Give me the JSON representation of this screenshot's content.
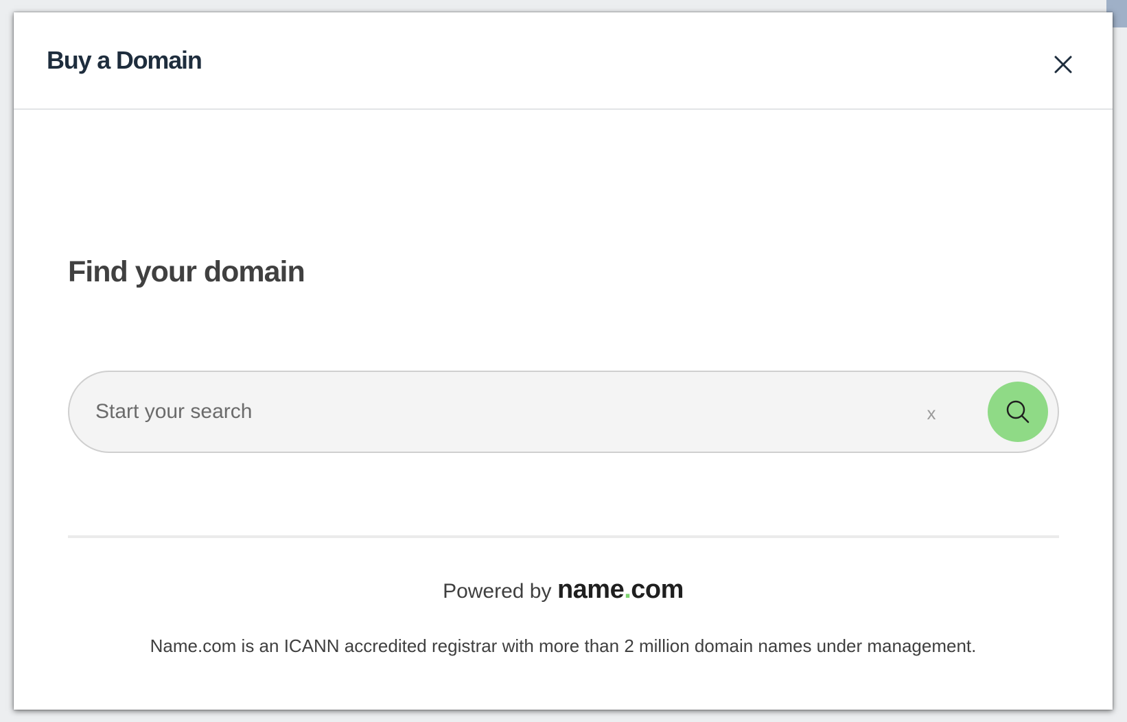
{
  "modal": {
    "title": "Buy a Domain"
  },
  "icons": {
    "close": "close-icon",
    "search": "search-icon"
  },
  "main": {
    "heading": "Find your domain",
    "search": {
      "placeholder": "Start your search",
      "value": "",
      "clear_label": "x"
    }
  },
  "footer": {
    "powered_by": "Powered by",
    "logo": {
      "name": "name",
      "dot": ".",
      "tld": "com"
    },
    "disclaimer": "Name.com is an ICANN accredited registrar with more than 2 million domain names under management."
  },
  "colors": {
    "accent": "#8fda86",
    "logo_dot": "#7ed470",
    "title": "#1e2d3d"
  }
}
